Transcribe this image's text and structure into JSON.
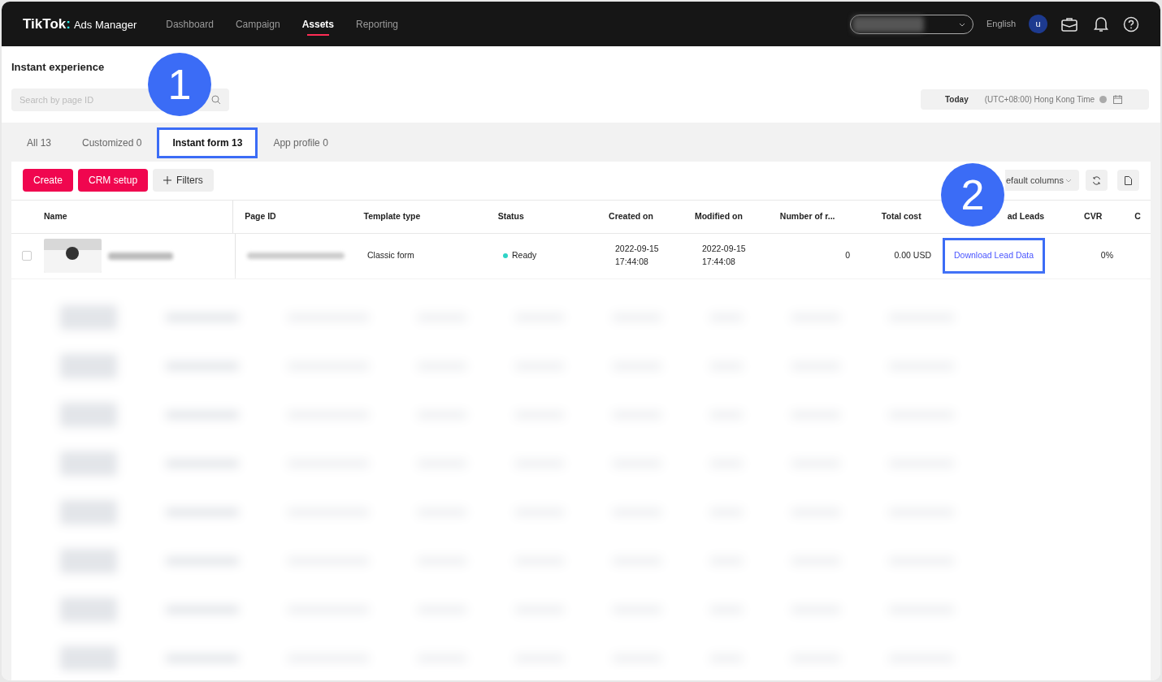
{
  "header": {
    "logo": "TikTok",
    "logo_separator": ":",
    "logo_sub": "Ads Manager",
    "nav": [
      {
        "label": "Dashboard",
        "selected": false
      },
      {
        "label": "Campaign",
        "selected": false
      },
      {
        "label": "Assets",
        "selected": true
      },
      {
        "label": "Reporting",
        "selected": false
      }
    ],
    "language": "English",
    "avatar": "u"
  },
  "page": {
    "title": "Instant experience",
    "search": {
      "placeholder": "Search by page ID"
    },
    "date_button": "Today",
    "timezone": "(UTC+08:00) Hong Kong Time"
  },
  "tabs": [
    {
      "label": "All 13",
      "selected": false,
      "highlighted": false
    },
    {
      "label": "Customized 0",
      "selected": false,
      "highlighted": false
    },
    {
      "label": "Instant form 13",
      "selected": true,
      "highlighted": true
    },
    {
      "label": "App profile 0",
      "selected": false,
      "highlighted": false
    }
  ],
  "toolbar": {
    "buttons": [
      {
        "label": "Create",
        "kind": "primary"
      },
      {
        "label": "CRM setup",
        "kind": "primary"
      },
      {
        "label": "Filters",
        "kind": "filter"
      }
    ],
    "columns_select": "efault columns"
  },
  "table": {
    "columns": [
      "Name",
      "Page ID",
      "Template type",
      "Status",
      "Created on",
      "Modified on",
      "Number of r...",
      "Total cost",
      "ad Leads",
      "CVR",
      "C"
    ],
    "rows": [
      {
        "checked": false,
        "template": "Classic form",
        "status": "Ready",
        "color": "#2ed3c6",
        "created": [
          "2022-09-15",
          "17:44:08"
        ],
        "modified": [
          "2022-09-15",
          "17:44:08"
        ],
        "number": "0",
        "total_cost": "0.00 USD",
        "download": "Download Lead Data",
        "download_highlighted": true,
        "cvr": "0%"
      }
    ]
  },
  "annotations": [
    {
      "label": "1"
    },
    {
      "label": "2"
    }
  ]
}
